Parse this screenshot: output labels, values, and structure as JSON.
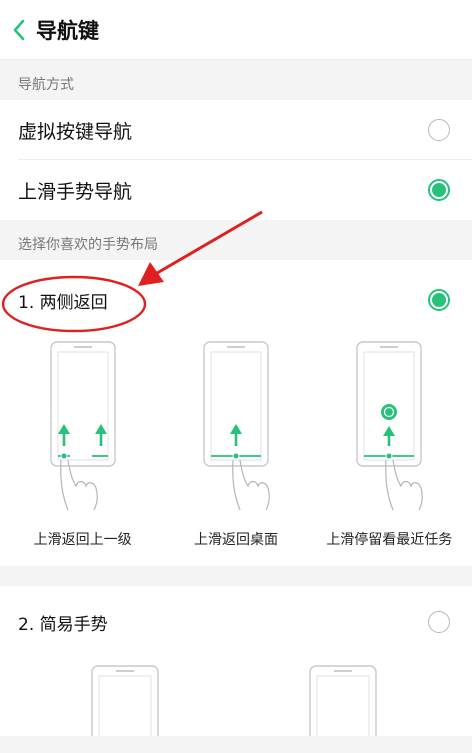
{
  "header": {
    "title": "导航键",
    "back_icon": "chevron-left-icon"
  },
  "nav_mode": {
    "section_label": "导航方式",
    "options": [
      {
        "label": "虚拟按键导航",
        "selected": false
      },
      {
        "label": "上滑手势导航",
        "selected": true
      }
    ]
  },
  "gesture_layout": {
    "section_label": "选择你喜欢的手势布局",
    "layouts": [
      {
        "label": "1. 两侧返回",
        "selected": true,
        "illustrations": [
          {
            "caption": "上滑返回上一级"
          },
          {
            "caption": "上滑返回桌面"
          },
          {
            "caption": "上滑停留看最近任务"
          }
        ]
      },
      {
        "label": "2. 简易手势",
        "selected": false
      }
    ]
  },
  "colors": {
    "accent": "#27c27a",
    "annotation": "#e02020"
  }
}
